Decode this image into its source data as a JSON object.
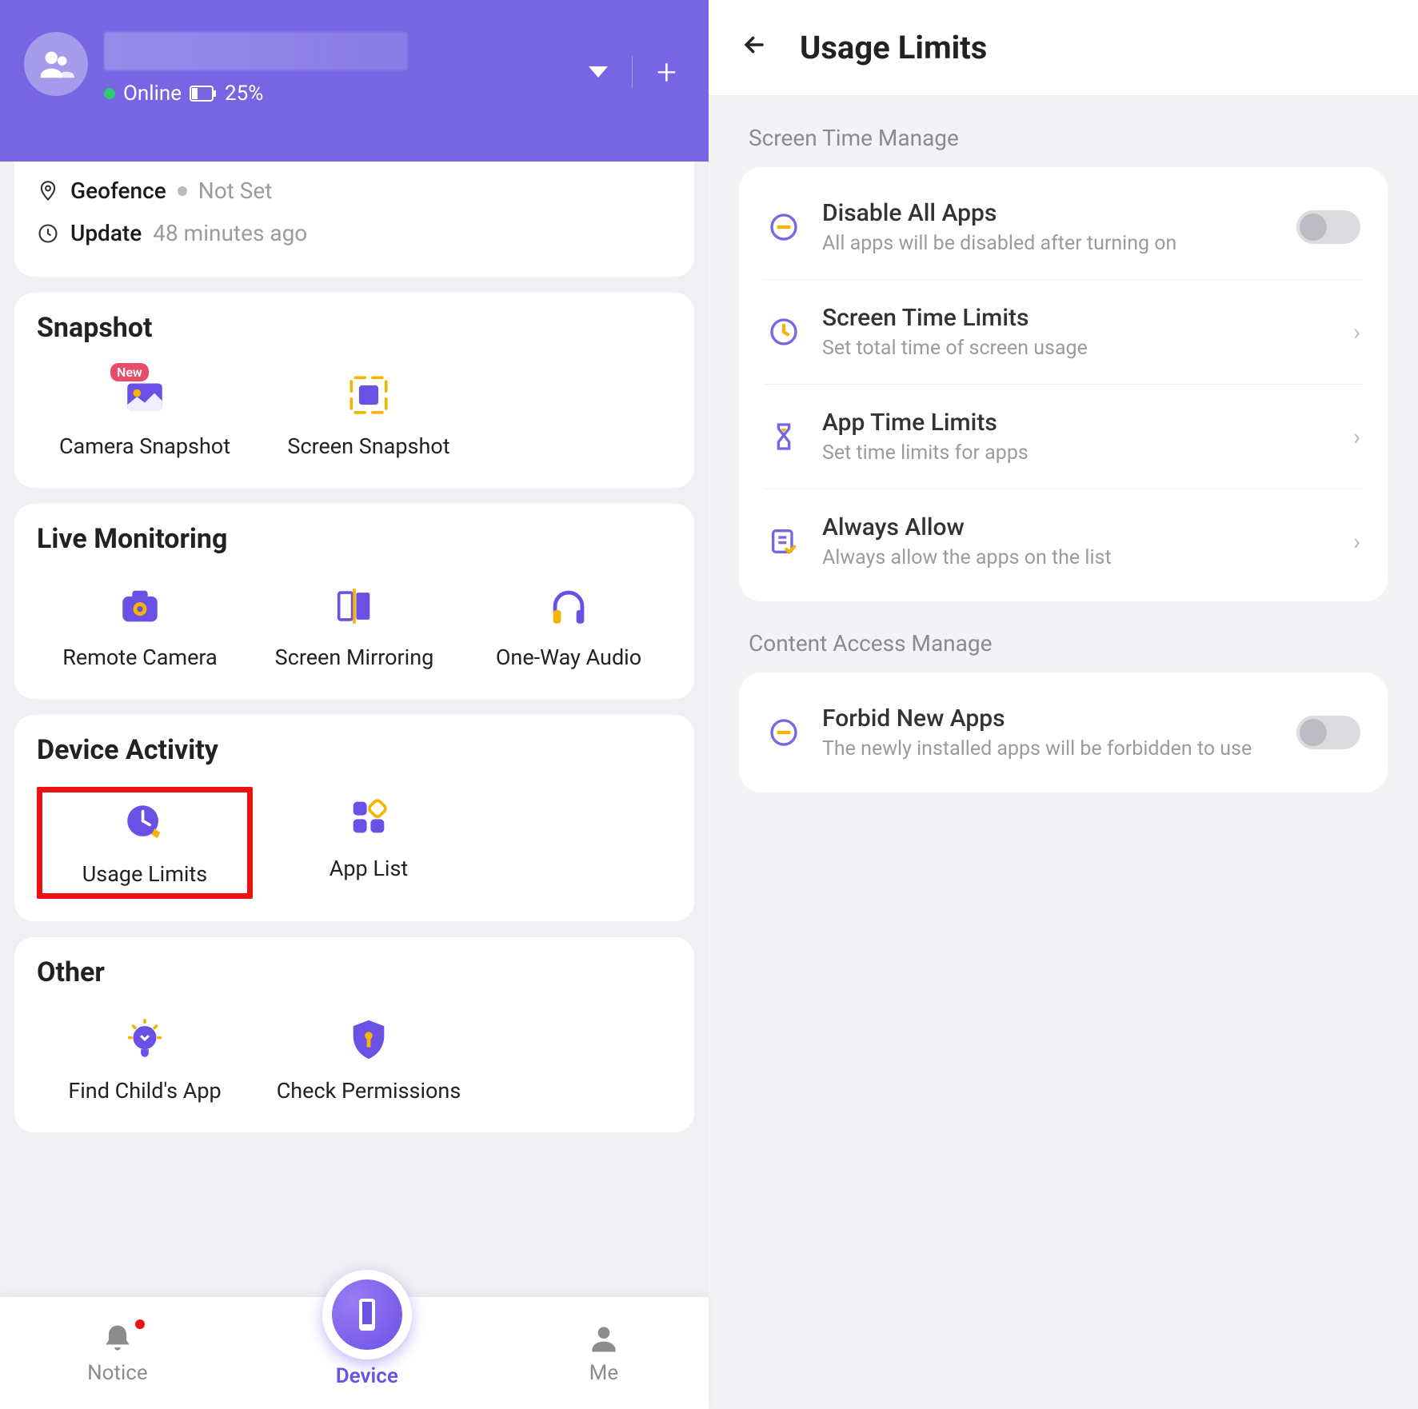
{
  "header": {
    "status_label": "Online",
    "battery": "25%"
  },
  "info": {
    "geofence_label": "Geofence",
    "geofence_value": "Not Set",
    "update_label": "Update",
    "update_value": "48 minutes ago"
  },
  "sections": {
    "snapshot": {
      "title": "Snapshot",
      "items": [
        {
          "label": "Camera Snapshot",
          "badge": "New"
        },
        {
          "label": "Screen Snapshot"
        }
      ]
    },
    "live": {
      "title": "Live Monitoring",
      "items": [
        {
          "label": "Remote Camera"
        },
        {
          "label": "Screen Mirroring"
        },
        {
          "label": "One-Way Audio"
        }
      ]
    },
    "activity": {
      "title": "Device Activity",
      "items": [
        {
          "label": "Usage Limits"
        },
        {
          "label": "App List"
        }
      ]
    },
    "other": {
      "title": "Other",
      "items": [
        {
          "label": "Find Child's App"
        },
        {
          "label": "Check Permissions"
        }
      ]
    }
  },
  "bottomnav": {
    "notice": "Notice",
    "device": "Device",
    "me": "Me"
  },
  "right": {
    "title": "Usage Limits",
    "section1": "Screen Time Manage",
    "section2": "Content Access Manage",
    "rows": {
      "disable": {
        "title": "Disable All Apps",
        "sub": "All apps will be disabled after turning on"
      },
      "screen": {
        "title": "Screen Time Limits",
        "sub": "Set total time of screen usage"
      },
      "app": {
        "title": "App Time Limits",
        "sub": "Set time limits for apps"
      },
      "allow": {
        "title": "Always Allow",
        "sub": "Always allow the apps on the list"
      },
      "forbid": {
        "title": "Forbid New Apps",
        "sub": "The newly installed apps will be forbidden to use"
      }
    }
  }
}
